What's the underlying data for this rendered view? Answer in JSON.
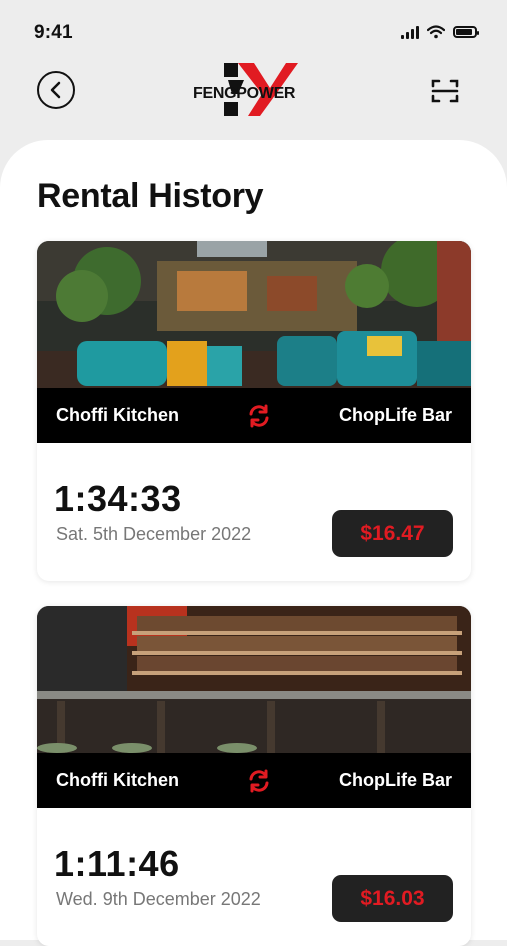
{
  "status_bar": {
    "time": "9:41"
  },
  "header": {
    "logo_text": "FENGPOWER",
    "brand_color": "#e11b22"
  },
  "page": {
    "title": "Rental History"
  },
  "rentals": [
    {
      "image": "restaurant-interior-photo",
      "from": "Choffi Kitchen",
      "to": "ChopLife Bar",
      "duration": "1:34:33",
      "date": "Sat. 5th December 2022",
      "price": "$16.47"
    },
    {
      "image": "bar-counter-photo",
      "from": "Choffi Kitchen",
      "to": "ChopLife Bar",
      "duration": "1:11:46",
      "date": "Wed. 9th December 2022",
      "price": "$16.03"
    }
  ],
  "icons": {
    "back": "chevron-left-circle-icon",
    "scan": "scan-frame-icon",
    "swap": "refresh-swap-icon"
  }
}
